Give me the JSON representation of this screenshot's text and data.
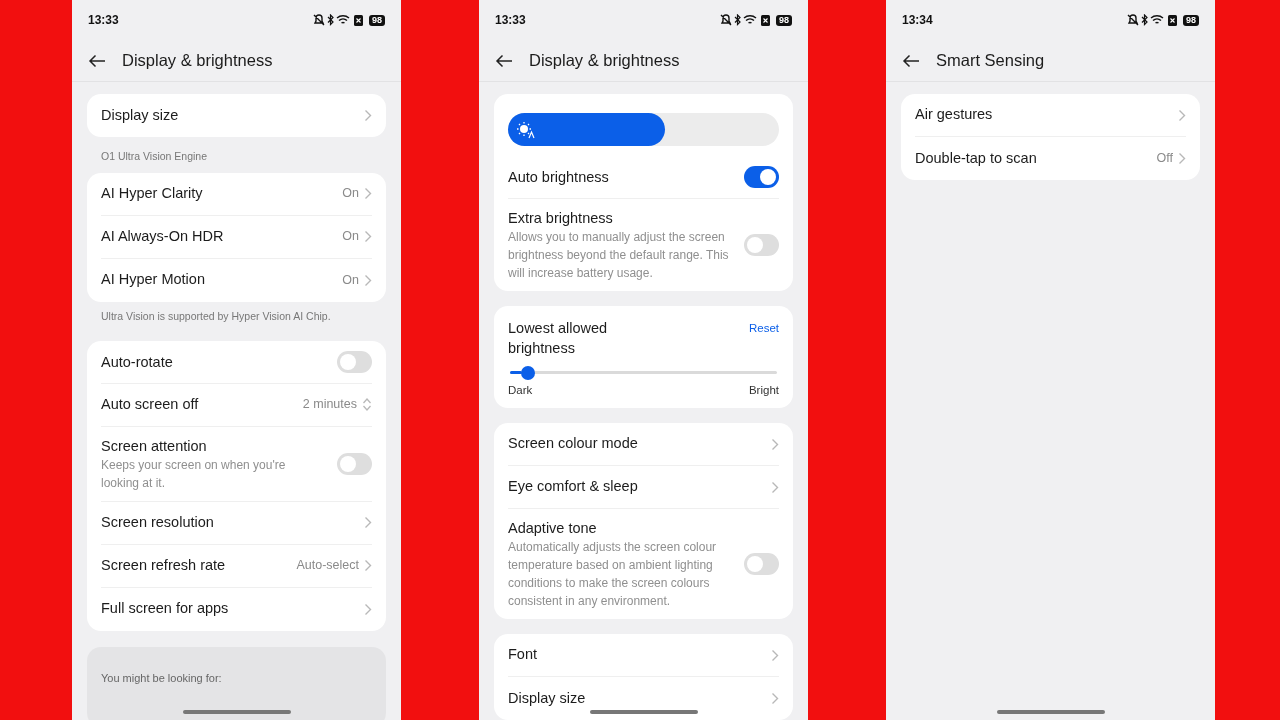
{
  "screens": [
    {
      "time": "13:33",
      "battery": "98",
      "title": "Display & brightness",
      "groups": [
        {
          "items": [
            {
              "kind": "nav",
              "label": "Display size"
            }
          ]
        },
        {
          "caption": "O1 Ultra Vision Engine",
          "items": [
            {
              "kind": "nav",
              "label": "AI Hyper Clarity",
              "value": "On"
            },
            {
              "kind": "nav",
              "label": "AI Always-On HDR",
              "value": "On"
            },
            {
              "kind": "nav",
              "label": "AI Hyper Motion",
              "value": "On"
            }
          ],
          "note": "Ultra Vision is supported by Hyper Vision AI Chip."
        },
        {
          "items": [
            {
              "kind": "toggle",
              "label": "Auto-rotate",
              "on": false
            },
            {
              "kind": "select",
              "label": "Auto screen off",
              "value": "2 minutes"
            },
            {
              "kind": "toggle",
              "label": "Screen attention",
              "description": "Keeps your screen on when you're looking at it.",
              "on": false
            },
            {
              "kind": "nav",
              "label": "Screen resolution"
            },
            {
              "kind": "nav",
              "label": "Screen refresh rate",
              "value": "Auto-select"
            },
            {
              "kind": "nav",
              "label": "Full screen for apps"
            }
          ]
        },
        {
          "kind": "suggestions",
          "caption": "You might be looking for:"
        }
      ]
    },
    {
      "time": "13:33",
      "battery": "98",
      "title": "Display & brightness",
      "groups": [
        {
          "items": [
            {
              "kind": "brightness",
              "level": 0.58
            },
            {
              "kind": "toggle",
              "label": "Auto brightness",
              "on": true
            },
            {
              "kind": "toggle",
              "label": "Extra brightness",
              "description": "Allows you to manually adjust the screen brightness beyond the default range. This will increase battery usage.",
              "on": false
            }
          ]
        },
        {
          "items": [
            {
              "kind": "range",
              "label": "Lowest allowed brightness",
              "action": "Reset",
              "level": 0.04,
              "min_label": "Dark",
              "max_label": "Bright"
            }
          ]
        },
        {
          "items": [
            {
              "kind": "nav",
              "label": "Screen colour mode"
            },
            {
              "kind": "nav",
              "label": "Eye comfort & sleep"
            },
            {
              "kind": "toggle",
              "label": "Adaptive tone",
              "description": "Automatically adjusts the screen colour temperature based on ambient lighting conditions to make the screen colours consistent in any environment.",
              "on": false
            }
          ]
        },
        {
          "items": [
            {
              "kind": "nav",
              "label": "Font"
            },
            {
              "kind": "nav",
              "label": "Display size"
            }
          ]
        }
      ]
    },
    {
      "time": "13:34",
      "battery": "98",
      "title": "Smart Sensing",
      "groups": [
        {
          "items": [
            {
              "kind": "nav",
              "label": "Air gestures"
            },
            {
              "kind": "nav",
              "label": "Double-tap to scan",
              "value": "Off"
            }
          ]
        }
      ]
    }
  ]
}
